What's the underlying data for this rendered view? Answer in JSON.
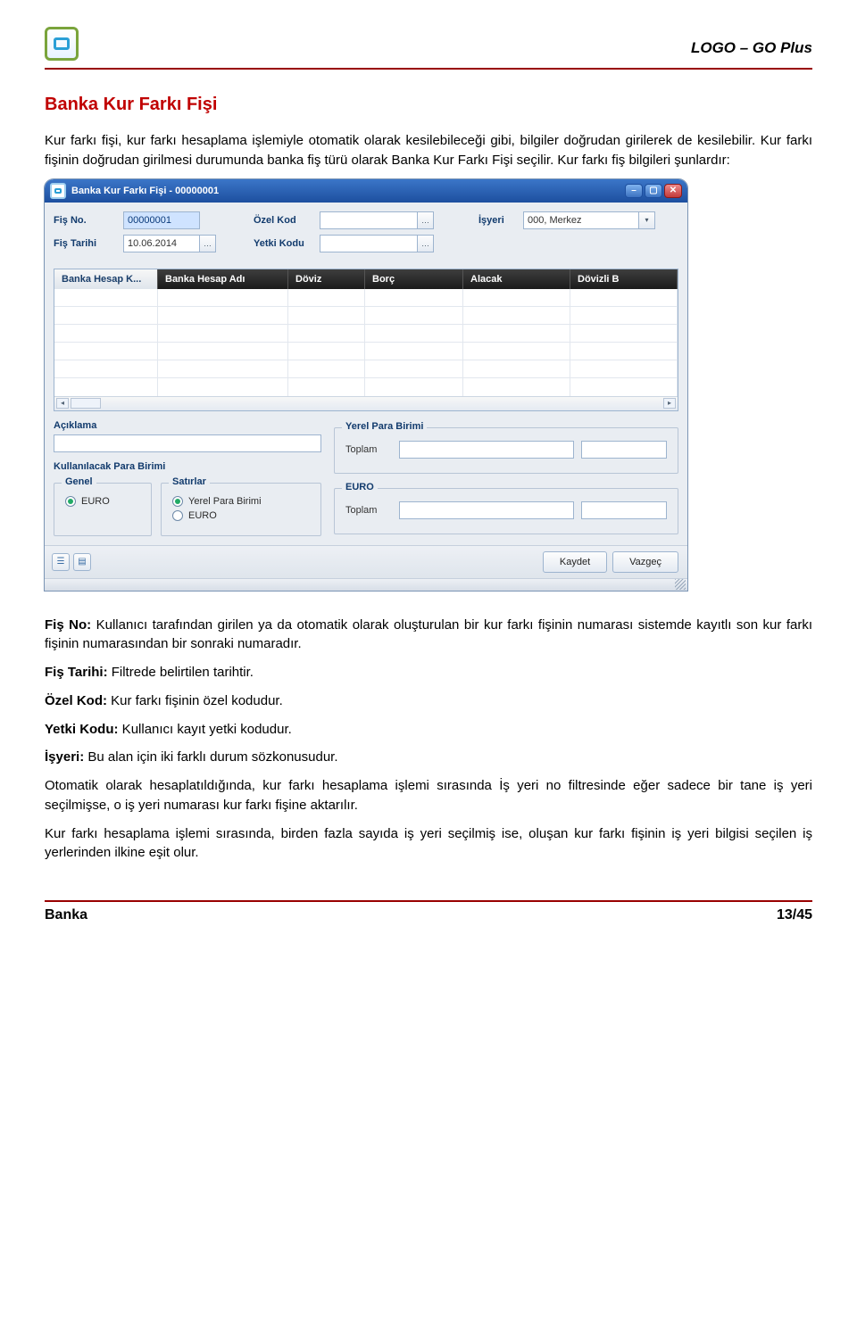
{
  "doc": {
    "brand": "LOGO – GO Plus",
    "section_title": "Banka Kur Farkı Fişi",
    "intro": "Kur farkı fişi, kur farkı hesaplama işlemiyle otomatik olarak kesilebileceği gibi, bilgiler doğrudan girilerek de kesilebilir. Kur farkı fişinin doğrudan girilmesi durumunda banka fiş türü olarak Banka Kur Farkı Fişi seçilir. Kur farkı fiş bilgileri şunlardır:",
    "p1_b": "Fiş No:",
    "p1": " Kullanıcı tarafından girilen ya da otomatik olarak oluşturulan bir kur farkı fişinin numarası sistemde kayıtlı son kur farkı fişinin numarasından bir sonraki numaradır.",
    "p2_b": "Fiş Tarihi:",
    "p2": " Filtrede belirtilen tarihtir.",
    "p3_b": "Özel Kod:",
    "p3": " Kur farkı fişinin özel kodudur.",
    "p4_b": "Yetki Kodu:",
    "p4": " Kullanıcı kayıt yetki kodudur.",
    "p5_b": "İşyeri:",
    "p5": " Bu alan için iki farklı durum sözkonusudur.",
    "p6": "Otomatik olarak hesaplatıldığında, kur farkı hesaplama işlemi sırasında İş yeri no filtresinde eğer sadece bir tane iş yeri seçilmişse, o iş yeri numarası kur farkı fişine aktarılır.",
    "p7": "Kur farkı hesaplama işlemi sırasında, birden fazla sayıda iş yeri seçilmiş ise, oluşan kur farkı fişinin iş yeri bilgisi seçilen iş yerlerinden ilkine eşit olur.",
    "footer_left": "Banka",
    "footer_right": "13/45"
  },
  "win": {
    "title": "Banka Kur Farkı Fişi - 00000001",
    "labels": {
      "fis_no": "Fiş No.",
      "fis_tarihi": "Fiş Tarihi",
      "ozel_kod": "Özel Kod",
      "yetki_kodu": "Yetki Kodu",
      "isyeri": "İşyeri",
      "aciklama": "Açıklama",
      "kullanilacak": "Kullanılacak Para Birimi",
      "genel": "Genel",
      "satirlar": "Satırlar",
      "yerel": "Yerel Para Birimi",
      "euro_grp": "EURO",
      "toplam": "Toplam"
    },
    "values": {
      "fis_no": "00000001",
      "fis_tarihi": "10.06.2014",
      "ozel_kod": "",
      "yetki_kodu": "",
      "isyeri": "000, Merkez"
    },
    "radios": {
      "genel_euro": "EURO",
      "satir_yerel": "Yerel Para Birimi",
      "satir_euro": "EURO"
    },
    "columns": [
      "Banka Hesap K...",
      "Banka Hesap Adı",
      "Döviz",
      "Borç",
      "Alacak",
      "Dövizli B"
    ],
    "buttons": {
      "save": "Kaydet",
      "cancel": "Vazgeç"
    }
  }
}
